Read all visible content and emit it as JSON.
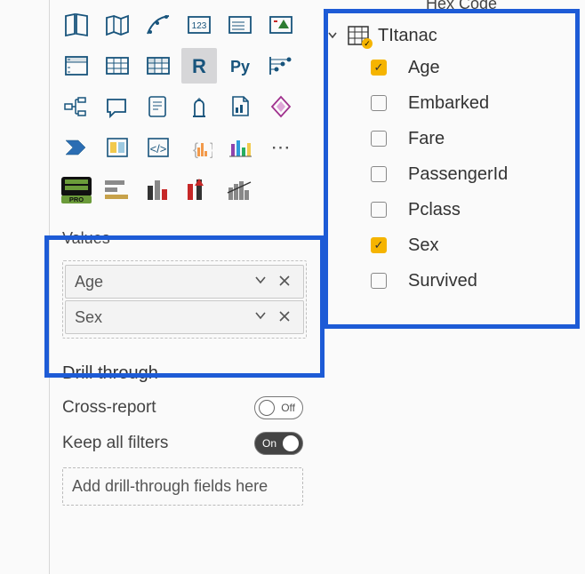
{
  "visualizations": {
    "icons_row4_special": {
      "r_label": "R",
      "py_label": "Py"
    }
  },
  "values_section": {
    "title": "Values",
    "fields": [
      {
        "name": "Age"
      },
      {
        "name": "Sex"
      }
    ]
  },
  "drill_section": {
    "title": "Drill through",
    "cross_report_label": "Cross-report",
    "cross_report_state": "Off",
    "keep_filters_label": "Keep all filters",
    "keep_filters_state": "On",
    "add_placeholder": "Add drill-through fields here"
  },
  "fields_panel": {
    "truncated_row": "Hex Code",
    "table_name": "TItanac",
    "fields": [
      {
        "name": "Age",
        "checked": true
      },
      {
        "name": "Embarked",
        "checked": false
      },
      {
        "name": "Fare",
        "checked": false
      },
      {
        "name": "PassengerId",
        "checked": false
      },
      {
        "name": "Pclass",
        "checked": false
      },
      {
        "name": "Sex",
        "checked": true
      },
      {
        "name": "Survived",
        "checked": false
      }
    ]
  }
}
